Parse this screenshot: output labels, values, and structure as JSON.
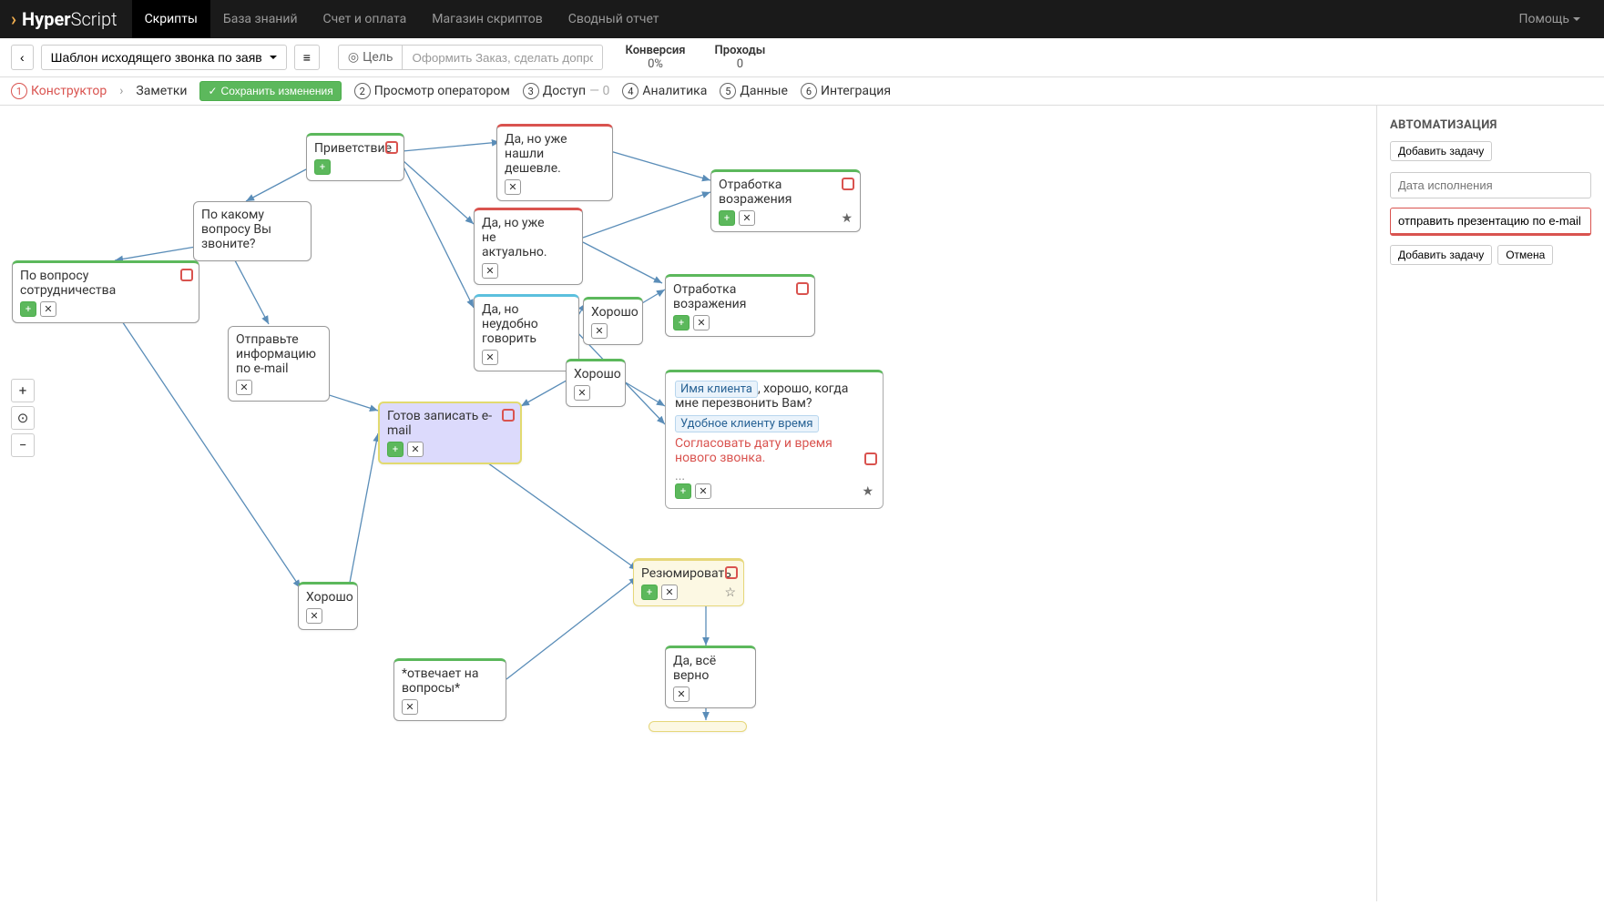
{
  "brand": {
    "name_bold": "Hyper",
    "name_light": "Script"
  },
  "topnav": {
    "items": [
      "Скрипты",
      "База знаний",
      "Счет и оплата",
      "Магазин скриптов",
      "Сводный отчет"
    ],
    "active": 0,
    "help": "Помощь"
  },
  "toolbar": {
    "back": "‹",
    "template": "Шаблон исходящего звонка по заяв",
    "menu": "≡",
    "goal_label": "Цель",
    "goal_text": "Оформить Заказ, сделать допродажу",
    "stats": [
      {
        "label": "Конверсия",
        "value": "0%"
      },
      {
        "label": "Проходы",
        "value": "0"
      }
    ]
  },
  "subtabs": {
    "constructor": "Конструктор",
    "notes": "Заметки",
    "save": "Сохранить изменения",
    "items": [
      {
        "n": "2",
        "label": "Просмотр оператором"
      },
      {
        "n": "3",
        "label": "Доступ",
        "suffix": "— 0"
      },
      {
        "n": "4",
        "label": "Аналитика"
      },
      {
        "n": "5",
        "label": "Данные"
      },
      {
        "n": "6",
        "label": "Интеграция"
      }
    ]
  },
  "zoom": {
    "in": "+",
    "center": "⊙",
    "out": "−"
  },
  "nodes": {
    "greet": "Приветствие",
    "q": "По какому вопросу Вы звоните?",
    "coop": "По вопросу сотрудничества",
    "send": "Отправьте информацию по e-mail",
    "cheaper": "Да, но уже нашли дешевле.",
    "notactual": "Да, но уже не актуально.",
    "busy": "Да, но неудобно говорить",
    "obj1": "Отработка возражения",
    "obj2": "Отработка возражения",
    "ok1": "Хорошо",
    "ok2": "Хорошо",
    "ok3": "Хорошо",
    "email": "Готов записать e-mail",
    "sum": "Резюмировать",
    "yes": "Да, всё верно",
    "ans": "*отвечает на вопросы*",
    "detail": {
      "tag1": "Имя клиента",
      "t1": ", хорошо, когда мне перезвонить Вам?",
      "tag2": "Удобное клиенту время",
      "red": "Согласовать дату и время нового звонка.",
      "dots": "..."
    }
  },
  "sidebar": {
    "title": "АВТОМАТИЗАЦИЯ",
    "add_task": "Добавить задачу",
    "date_ph": "Дата исполнения",
    "task_val": "отправить презентацию по e-mail",
    "add": "Добавить задачу",
    "cancel": "Отмена"
  }
}
